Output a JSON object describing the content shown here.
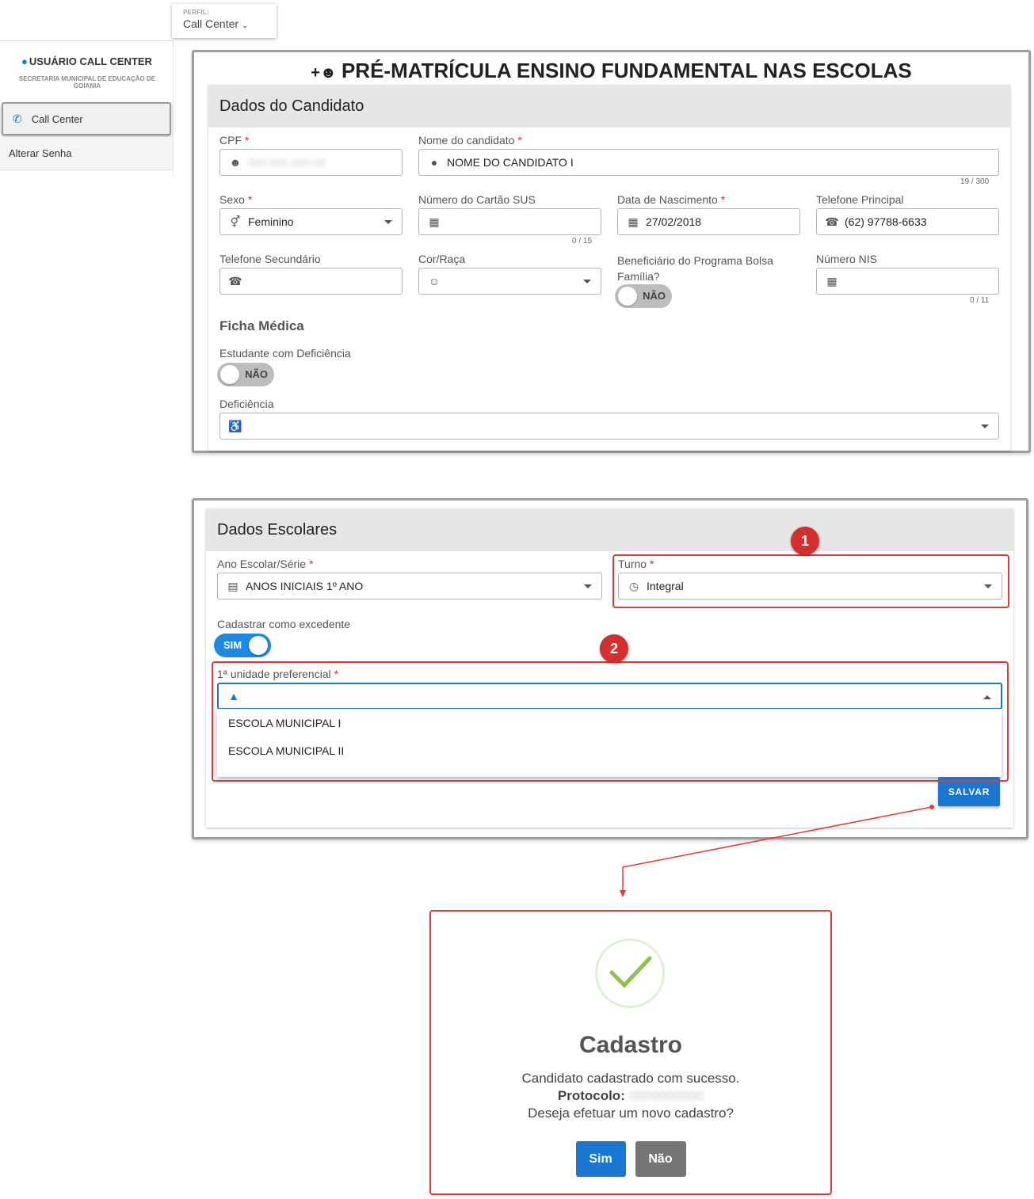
{
  "perfil": {
    "caption": "PERFIL:",
    "value": "Call Center"
  },
  "sidebar": {
    "user_name": "USUÁRIO CALL CENTER",
    "organization": "SECRETARIA MUNICIPAL DE EDUCAÇÃO DE GOIANIA",
    "items": [
      {
        "label": "Call Center",
        "icon": "phone-icon",
        "active": true
      },
      {
        "label": "Alterar Senha"
      }
    ]
  },
  "page": {
    "title": "PRÉ-MATRÍCULA ENSINO FUNDAMENTAL NAS ESCOLAS",
    "title_icon": "add-users-icon"
  },
  "candidato": {
    "section_title": "Dados do Candidato",
    "cpf": {
      "label": "CPF",
      "required": "*",
      "value": "000.000.000-00"
    },
    "nome": {
      "label": "Nome do candidato",
      "required": "*",
      "value": "NOME DO CANDIDATO I",
      "counter": "19 / 300"
    },
    "sexo": {
      "label": "Sexo",
      "required": "*",
      "value": "Feminino"
    },
    "cartao_sus": {
      "label": "Número do Cartão SUS",
      "value": "",
      "counter": "0 / 15"
    },
    "nascimento": {
      "label": "Data de Nascimento",
      "required": "*",
      "value": "27/02/2018"
    },
    "telefone_principal": {
      "label": "Telefone Principal",
      "value": "(62) 97788-6633"
    },
    "telefone_secundario": {
      "label": "Telefone Secundário",
      "value": ""
    },
    "cor_raca": {
      "label": "Cor/Raça",
      "value": ""
    },
    "bolsa_familia": {
      "label": "Beneficiário do Programa Bolsa Família?",
      "toggle": "NÃO",
      "on": false
    },
    "nis": {
      "label": "Número NIS",
      "value": "",
      "counter": "0 / 11"
    }
  },
  "ficha_medica": {
    "title": "Ficha Médica",
    "deficiencia_toggle": {
      "label": "Estudante com Deficiência",
      "toggle": "NÃO",
      "on": false
    },
    "deficiencia": {
      "label": "Deficiência",
      "value": ""
    }
  },
  "escolares": {
    "section_title": "Dados Escolares",
    "ano": {
      "label": "Ano Escolar/Série",
      "required": "*",
      "value": "ANOS INICIAIS 1º ANO"
    },
    "turno": {
      "label": "Turno",
      "required": "*",
      "value": "Integral"
    },
    "excedente": {
      "label": "Cadastrar como excedente",
      "toggle": "SIM",
      "on": true
    },
    "unidade": {
      "label": "1ª unidade preferencial",
      "required": "*",
      "value": "",
      "options": [
        "ESCOLA MUNICIPAL I",
        "ESCOLA MUNICIPAL II"
      ]
    },
    "save_label": "SALVAR"
  },
  "annotations": {
    "badge1": "1",
    "badge2": "2",
    "highlight_color": "#e53935"
  },
  "modal": {
    "title": "Cadastro",
    "message": "Candidato cadastrado com sucesso.",
    "protocol_label": "Protocolo:",
    "protocol_value": "0000000000",
    "question": "Deseja efetuar um novo cadastro?",
    "yes_label": "Sim",
    "no_label": "Não"
  },
  "colors": {
    "primary": "#1976d2",
    "danger": "#d32f2f",
    "success": "#8bc34a",
    "neutral": "#757575"
  }
}
